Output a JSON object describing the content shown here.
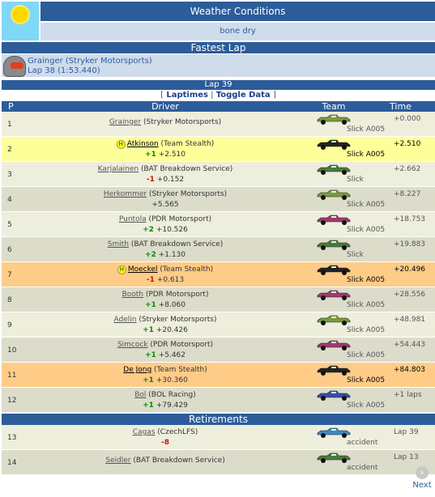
{
  "weather": {
    "title": "Weather Conditions",
    "value": "bone dry",
    "icon": "sun-icon"
  },
  "fastest_lap": {
    "title": "Fastest Lap",
    "driver": "Grainger (Stryker Motorsports)",
    "lap": "Lap 38 (1:53.440)",
    "icon": "helmet-icon"
  },
  "lap": {
    "title": "Lap 39",
    "links_open": "[",
    "laptimes": "Laptimes",
    "sep": "|",
    "toggle": "Toggle Data",
    "links_close": "]"
  },
  "columns": {
    "p": "P",
    "driver": "Driver",
    "team": "Team",
    "time": "Time"
  },
  "rows": [
    {
      "pos": "1",
      "name": "Grainger",
      "team": " (Stryker Motorsports)",
      "change": "",
      "gap": "",
      "tyre": "Slick A005",
      "time": "+0.000",
      "car_color": "#7c9a3c"
    },
    {
      "pos": "2",
      "name": "Atkinson",
      "team": " (Team Stealth)",
      "change": "+1",
      "gap": "+2.510",
      "tyre": "Slick A005",
      "time": "+2.510",
      "car_color": "#222222",
      "badge": "H"
    },
    {
      "pos": "3",
      "name": "Karjalainen",
      "team": " (BAT Breakdown Service)",
      "change": "-1",
      "gap": "+0.152",
      "tyre": "Slick",
      "time": "+2.662",
      "car_color": "#4a7a3a"
    },
    {
      "pos": "4",
      "name": "Herkommer",
      "team": " (Stryker Motorsports)",
      "change": "",
      "gap": "+5.565",
      "tyre": "Slick A005",
      "time": "+8.227",
      "car_color": "#7c9a3c"
    },
    {
      "pos": "5",
      "name": "Puntola",
      "team": " (PDR Motorsport)",
      "change": "+2",
      "gap": "+10.526",
      "tyre": "Slick A005",
      "time": "+18.753",
      "car_color": "#a03a6a"
    },
    {
      "pos": "6",
      "name": "Smith",
      "team": " (BAT Breakdown Service)",
      "change": "+2",
      "gap": "+1.130",
      "tyre": "Slick",
      "time": "+19.883",
      "car_color": "#4a7a3a"
    },
    {
      "pos": "7",
      "name": "Moeckel",
      "team": " (Team Stealth)",
      "change": "-1",
      "gap": "+0.613",
      "tyre": "Slick A005",
      "time": "+20.496",
      "car_color": "#222222",
      "badge": "H"
    },
    {
      "pos": "8",
      "name": "Booth",
      "team": " (PDR Motorsport)",
      "change": "+1",
      "gap": "+8.060",
      "tyre": "Slick A005",
      "time": "+28.556",
      "car_color": "#a03a6a"
    },
    {
      "pos": "9",
      "name": "Adelin",
      "team": " (Stryker Motorsports)",
      "change": "+1",
      "gap": "+20.426",
      "tyre": "Slick A005",
      "time": "+48.981",
      "car_color": "#7c9a3c"
    },
    {
      "pos": "10",
      "name": "Simcock",
      "team": " (PDR Motorsport)",
      "change": "+1",
      "gap": "+5.462",
      "tyre": "Slick A005",
      "time": "+54.443",
      "car_color": "#a03a6a"
    },
    {
      "pos": "11",
      "name": "De Jong",
      "team": " (Team Stealth)",
      "change": "+1",
      "gap": "+30.360",
      "tyre": "Slick A005",
      "time": "+84.803",
      "car_color": "#222222"
    },
    {
      "pos": "12",
      "name": "Bol",
      "team": " (BOL Racing)",
      "change": "+1",
      "gap": "+79.429",
      "tyre": "Slick A005",
      "time": "+1 laps",
      "car_color": "#3a4aaa"
    }
  ],
  "retirements": {
    "title": "Retirements",
    "rows": [
      {
        "pos": "13",
        "name": "Cagas",
        "team": " (CzechLFS)",
        "change": "-8",
        "tyre": "accident",
        "time": "Lap 39",
        "car_color": "#3a8ac8"
      },
      {
        "pos": "14",
        "name": "Seidler",
        "team": " (BAT Breakdown Service)",
        "change": "",
        "tyre": "accident",
        "time": "Lap 13",
        "car_color": "#4a7a3a"
      }
    ]
  },
  "footer": {
    "next": "Next",
    "icon": "next-arrow-icon"
  }
}
